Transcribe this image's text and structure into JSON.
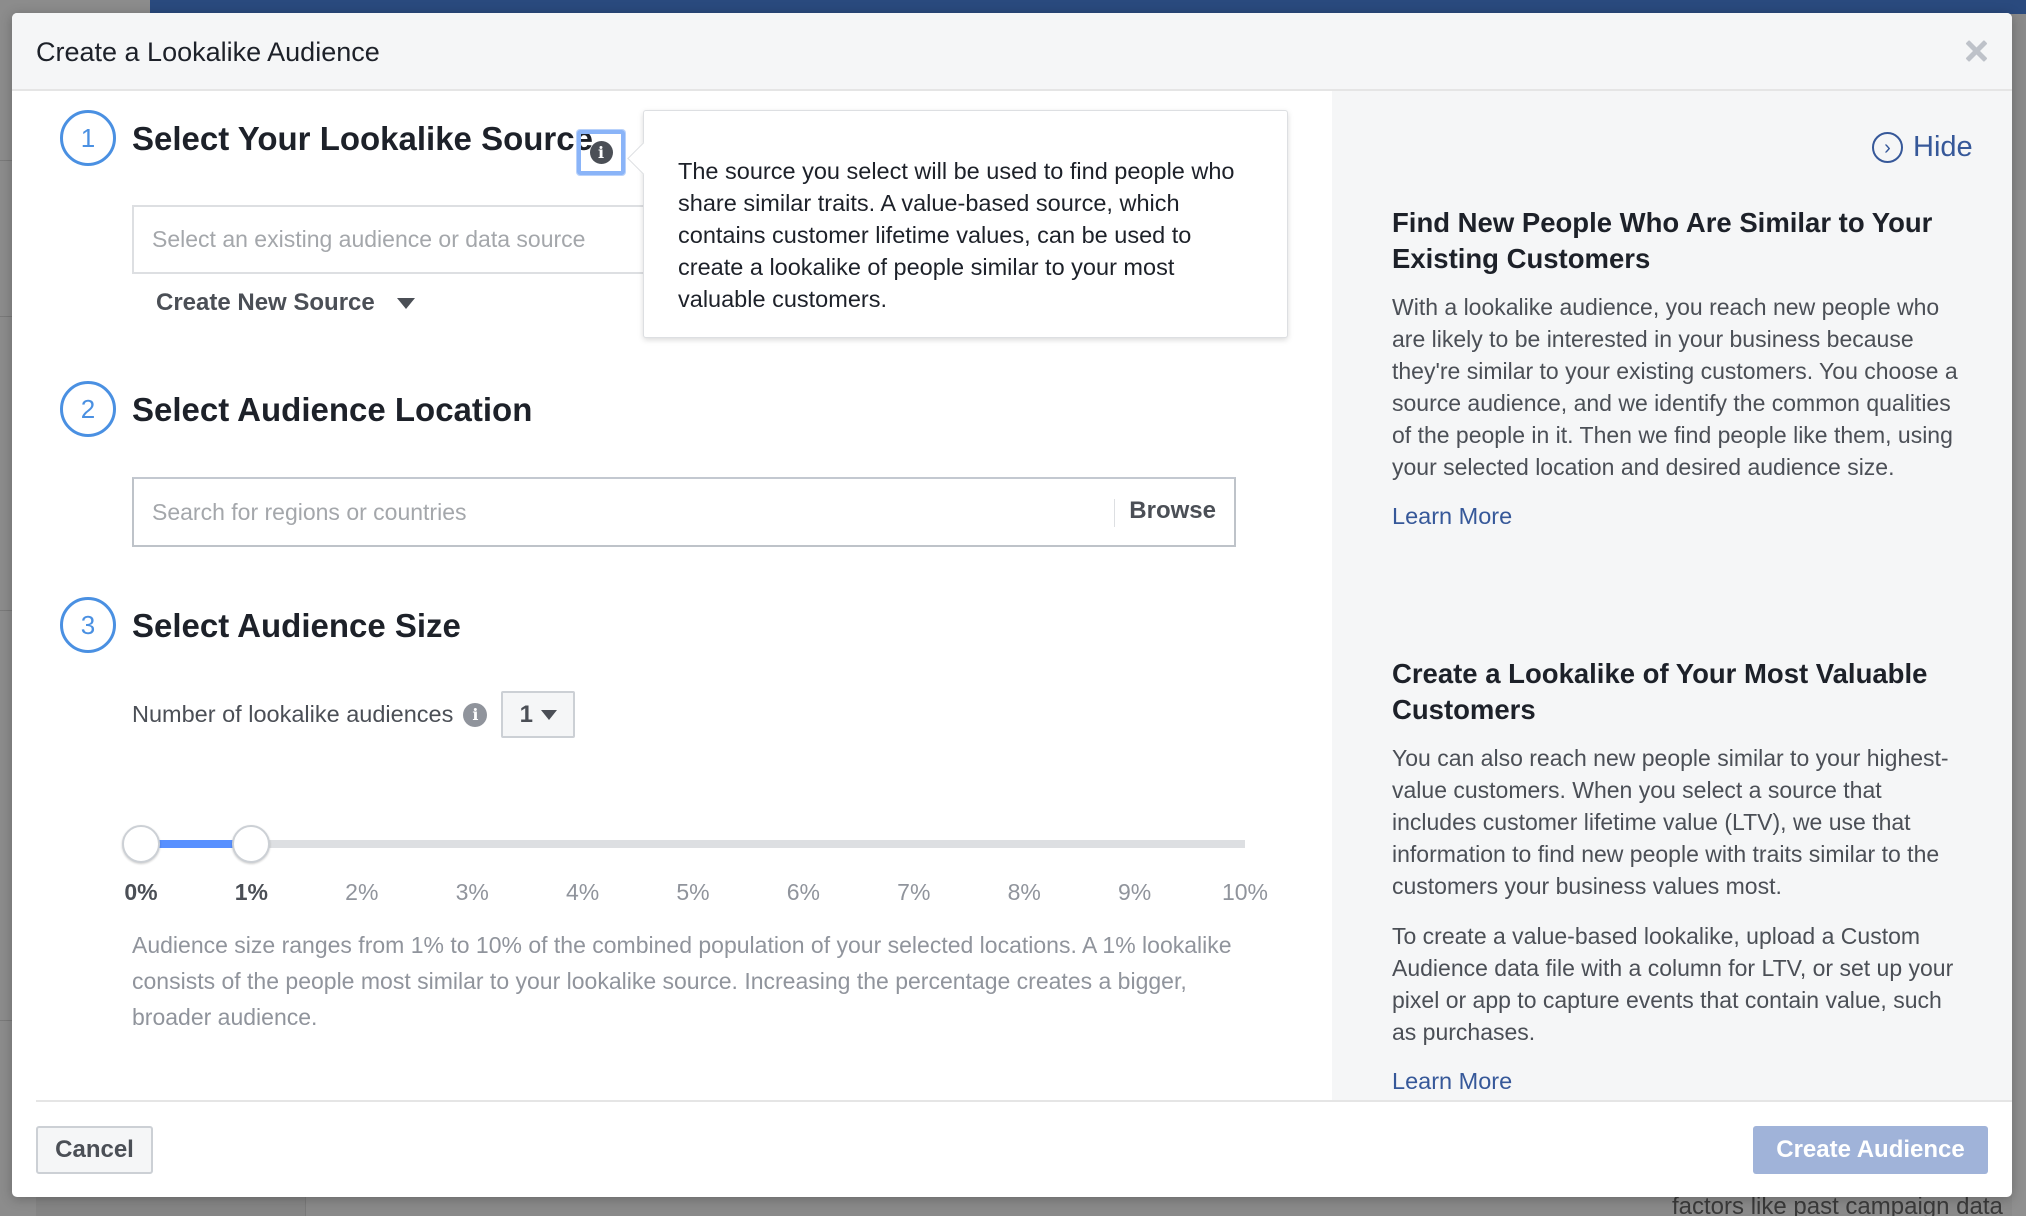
{
  "modal": {
    "title": "Create a Lookalike Audience",
    "close_icon": "close-icon"
  },
  "steps": [
    {
      "number": "1",
      "title": "Select Your Lookalike Source",
      "source_input": {
        "placeholder": "Select an existing audience or data source",
        "value": ""
      },
      "create_new_source_label": "Create New Source",
      "tooltip": "The source you select will be used to find people who share similar traits. A value-based source, which contains customer lifetime values, can be used to create a lookalike of people similar to your most valuable customers."
    },
    {
      "number": "2",
      "title": "Select Audience Location",
      "location_input": {
        "placeholder": "Search for regions or countries",
        "value": ""
      },
      "browse_label": "Browse"
    },
    {
      "number": "3",
      "title": "Select Audience Size",
      "number_label": "Number of lookalike audiences",
      "number_selected": "1",
      "slider": {
        "min_percent": 0,
        "max_percent": 10,
        "range_start_percent": 0,
        "range_end_percent": 1,
        "fill_color": "#5890ff",
        "labels": [
          "0%",
          "1%",
          "2%",
          "3%",
          "4%",
          "5%",
          "6%",
          "7%",
          "8%",
          "9%",
          "10%"
        ]
      },
      "description": "Audience size ranges from 1% to 10% of the combined population of your selected locations. A 1% lookalike consists of the people most similar to your lookalike source. Increasing the percentage creates a bigger, broader audience."
    }
  ],
  "info_panel": {
    "hide_label": "Hide",
    "sections": [
      {
        "heading": "Find New People Who Are Similar to Your Existing Customers",
        "paragraphs": [
          "With a lookalike audience, you reach new people who are likely to be interested in your business because they're similar to your existing customers. You choose a source audience, and we identify the common qualities of the people in it. Then we find people like them, using your selected location and desired audience size."
        ],
        "link": "Learn More"
      },
      {
        "heading": "Create a Lookalike of Your Most Valuable Customers",
        "paragraphs": [
          "You can also reach new people similar to your highest-value customers. When you select a source that includes customer lifetime value (LTV), we use that information to find new people with traits similar to the customers your business values most.",
          "To create a value-based lookalike, upload a Custom Audience data file with a column for LTV, or set up your pixel or app to capture events that contain value, such as purchases."
        ],
        "link": "Learn More"
      }
    ]
  },
  "footer": {
    "cancel_label": "Cancel",
    "create_label": "Create Audience"
  },
  "background": {
    "bottom_text": "factors like past campaign data"
  },
  "colors": {
    "accent_blue": "#4a90e2",
    "link_blue": "#365899",
    "disabled_primary": "#a0b3d9"
  }
}
